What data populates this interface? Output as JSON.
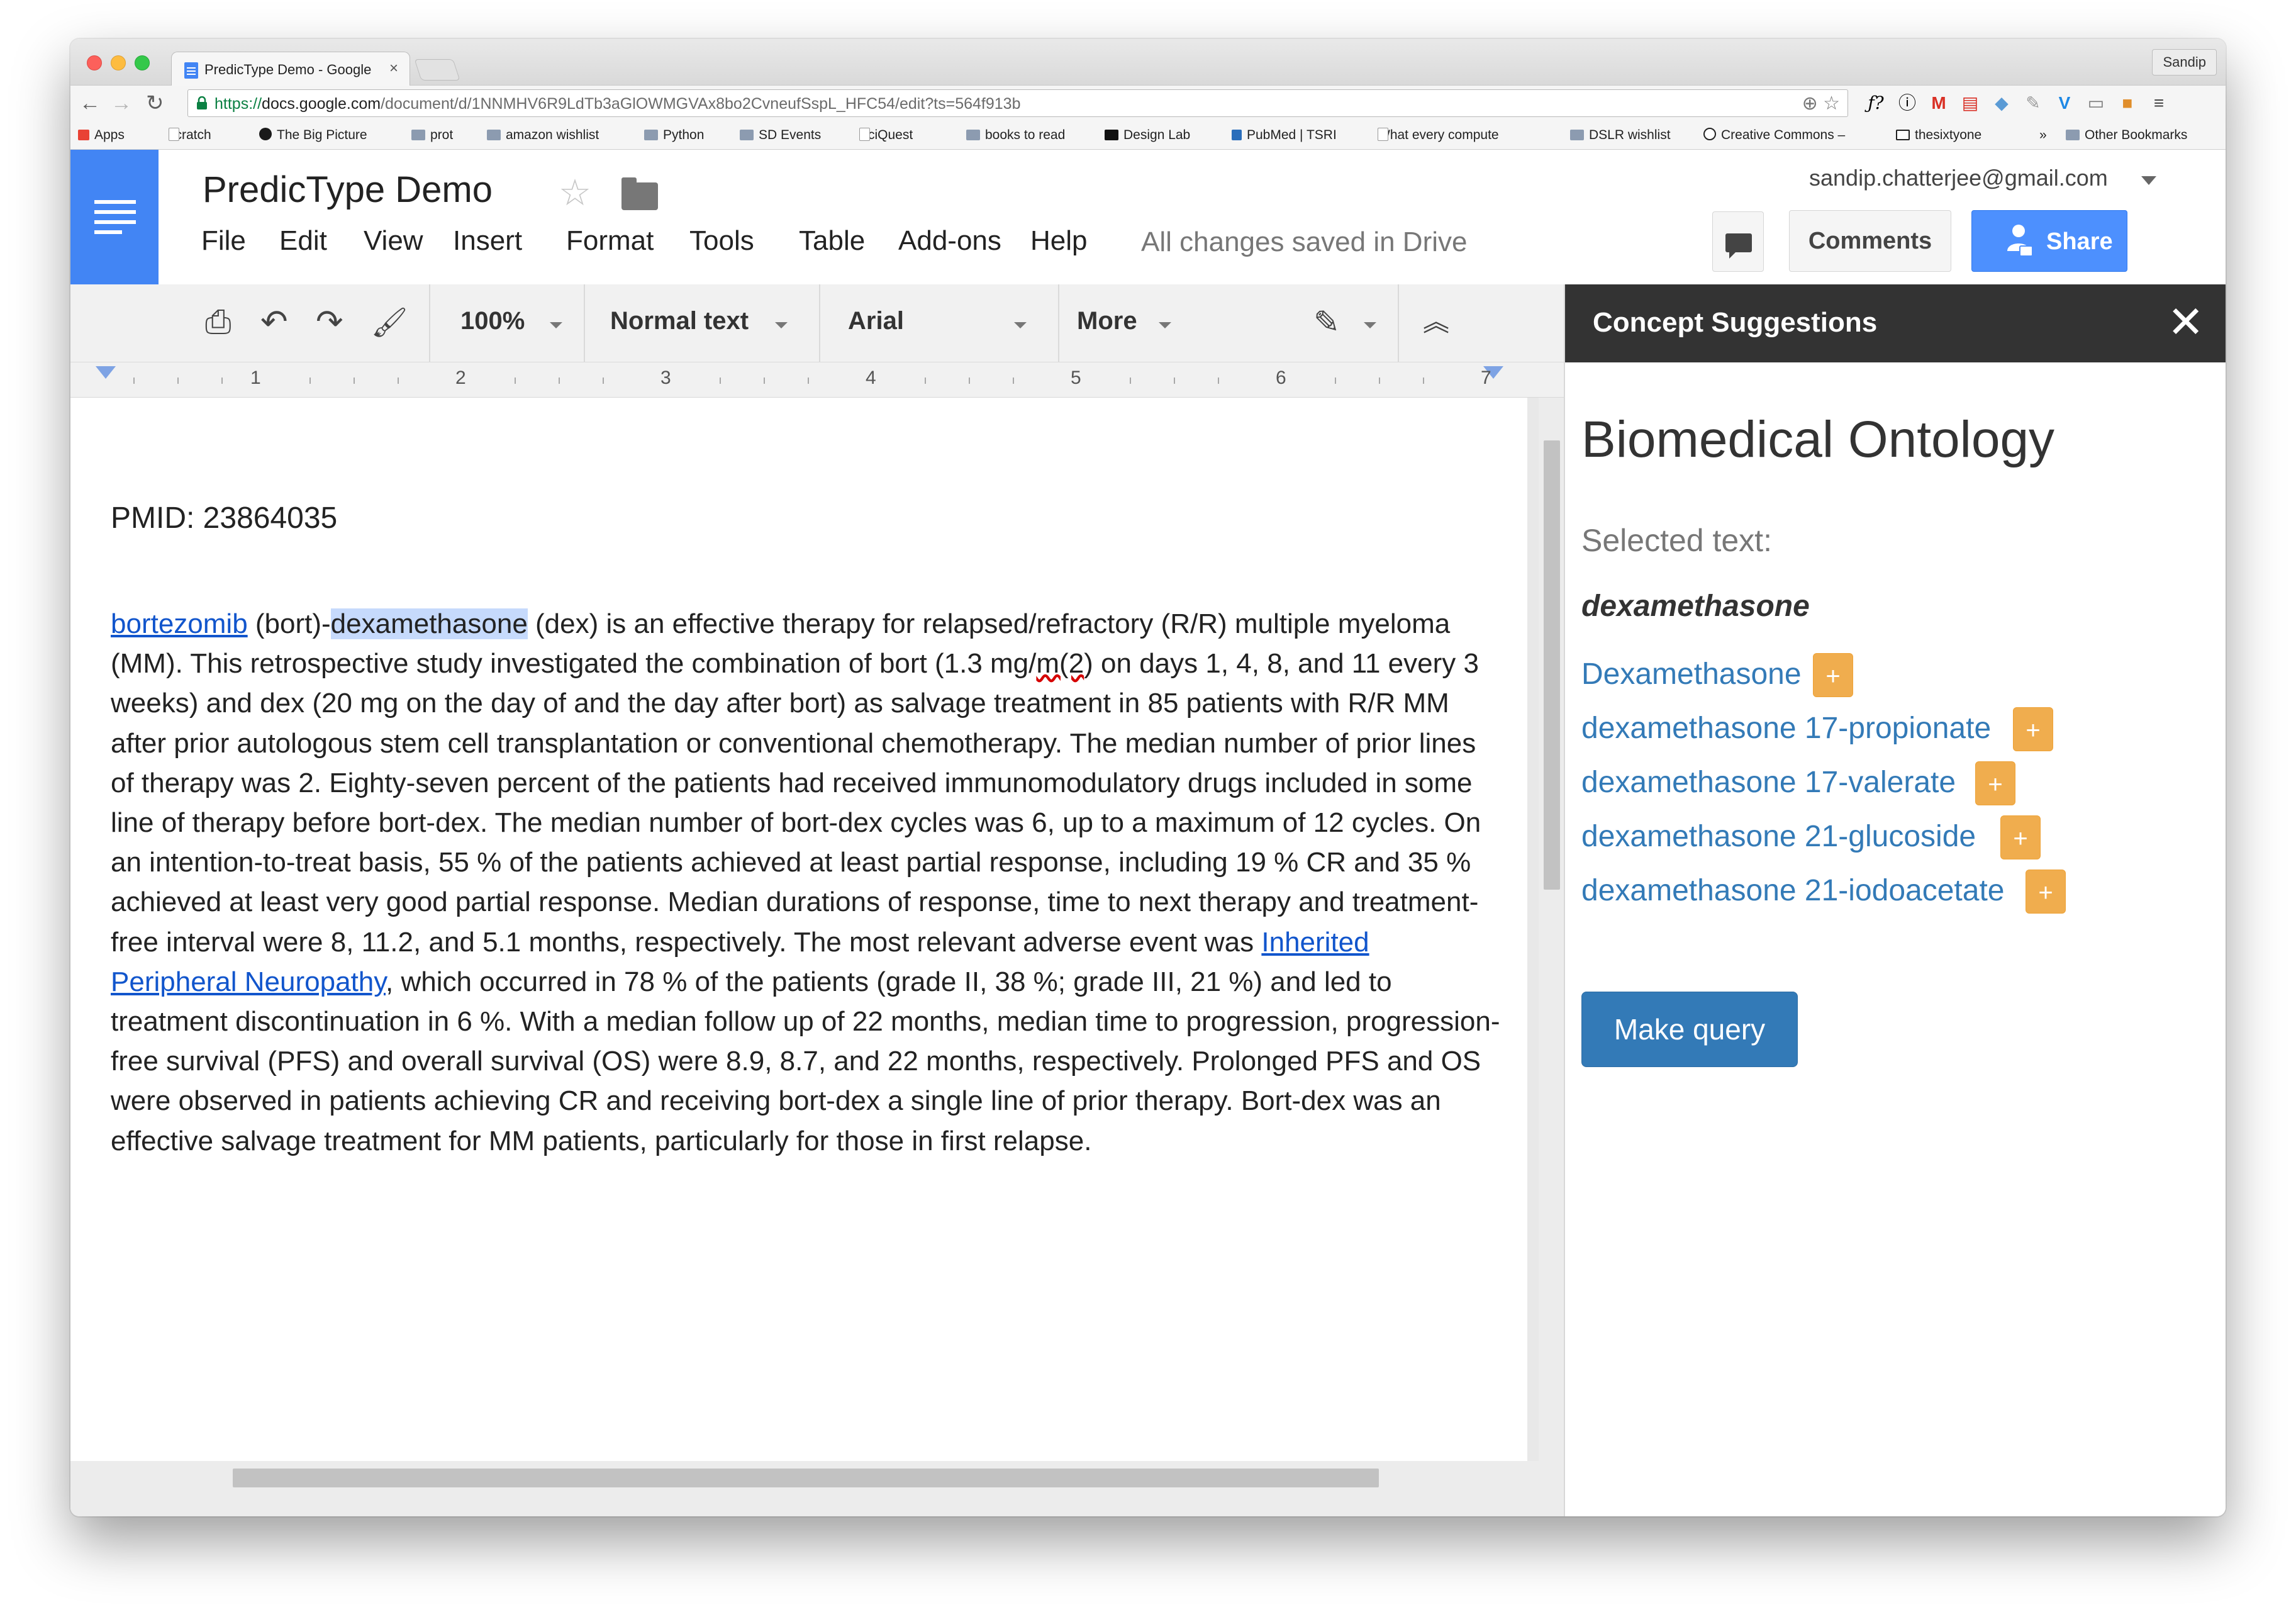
{
  "browser": {
    "tab_title": "PredicType Demo - Google",
    "tab_close": "×",
    "profile": "Sandip",
    "url": {
      "scheme": "https://",
      "host": "docs.google.com",
      "path": "/document/d/1NNMHV6R9LdTb3aGlOWMGVAx8bo2CvneufSspL_HFC54/edit?ts=564f913b"
    },
    "bookmarks": [
      {
        "label": "Apps",
        "icon": "apps-grid-icon"
      },
      {
        "label": "scratch",
        "icon": "page-icon"
      },
      {
        "label": "The Big Picture",
        "icon": "bookmark-b-icon"
      },
      {
        "label": "prot",
        "icon": "folder-icon"
      },
      {
        "label": "amazon wishlist",
        "icon": "folder-icon"
      },
      {
        "label": "Python",
        "icon": "folder-icon"
      },
      {
        "label": "SD Events",
        "icon": "folder-icon"
      },
      {
        "label": "SciQuest",
        "icon": "page-icon"
      },
      {
        "label": "books to read",
        "icon": "folder-icon"
      },
      {
        "label": "Design Lab",
        "icon": "dl-icon"
      },
      {
        "label": "PubMed | TSRI",
        "icon": "pubmed-icon"
      },
      {
        "label": "What every compute",
        "icon": "page-icon"
      },
      {
        "label": "DSLR wishlist",
        "icon": "folder-icon"
      },
      {
        "label": "Creative Commons –",
        "icon": "cc-icon"
      },
      {
        "label": "thesixtyone",
        "icon": "61-icon"
      },
      {
        "label": "»",
        "icon": ""
      },
      {
        "label": "Other Bookmarks",
        "icon": "folder-icon"
      }
    ]
  },
  "docs": {
    "title": "PredicType Demo",
    "menu": [
      "File",
      "Edit",
      "View",
      "Insert",
      "Format",
      "Tools",
      "Table",
      "Add-ons",
      "Help"
    ],
    "save_status": "All changes saved in Drive",
    "account": "sandip.chatterjee@gmail.com",
    "comments_label": "Comments",
    "share_label": "Share",
    "toolbar": {
      "zoom": "100%",
      "style": "Normal text",
      "font": "Arial",
      "more": "More"
    },
    "ruler_numbers": [
      "1",
      "2",
      "3",
      "4",
      "5",
      "6",
      "7"
    ]
  },
  "document": {
    "pmid": "PMID: 23864035",
    "p_link1": "bortezomib",
    "p_a": " (bort)-",
    "p_highlight": "dexamethasone",
    "p_b": " (dex) is an effective therapy for relapsed/refractory (R/R) multiple myeloma (MM). This retrospective study investigated the combination of bort (1.3 mg/",
    "p_squiggle": "m(2",
    "p_c": ") on days 1, 4, 8, and 11 every 3 weeks) and dex (20 mg on the day of and the day after bort) as salvage treatment in 85 patients with R/R MM after prior autologous stem cell transplantation or conventional chemotherapy. The median number of prior lines of therapy was 2. Eighty-seven percent of the patients had received immunomodulatory drugs included in some line of therapy before bort-dex. The median number of bort-dex cycles was 6, up to a maximum of 12 cycles. On an intention-to-treat basis, 55 % of the patients achieved at least partial response, including 19 % CR and 35 % achieved at least very good partial response. Median durations of response, time to next therapy and treatment-free interval were 8, 11.2, and 5.1 months, respectively. The most relevant adverse event was ",
    "p_link2": "Inherited Peripheral Neuropathy",
    "p_d": ", which occurred in 78 % of the patients (grade II, 38 %; grade III, 21 %) and led to treatment discontinuation in 6 %. With a median follow up of 22 months, median time to progression, progression-free survival (PFS) and overall survival (OS) were 8.9, 8.7, and 22 months, respectively. Prolonged PFS and OS were observed in patients achieving CR and receiving bort-dex a single line of prior therapy. Bort-dex was an effective salvage treatment for MM patients, particularly for those in first relapse."
  },
  "sidebar": {
    "header": "Concept Suggestions",
    "close": "✕",
    "ontology_title": "Biomedical Ontology",
    "selected_label": "Selected text:",
    "selected_term": "dexamethasone",
    "concepts": [
      {
        "label": "Dexamethasone",
        "add": "+"
      },
      {
        "label": "dexamethasone 17-propionate",
        "add": "+"
      },
      {
        "label": "dexamethasone 17-valerate",
        "add": "+"
      },
      {
        "label": "dexamethasone 21-glucoside",
        "add": "+"
      },
      {
        "label": "dexamethasone 21-iodoacetate",
        "add": "+"
      }
    ],
    "query_button": "Make query"
  },
  "colors": {
    "docs_blue": "#4285f4",
    "share_blue": "#4d90fe",
    "link_blue": "#337ab7",
    "add_orange": "#f0ad4e",
    "sidebar_header": "#333333",
    "selection_highlight": "#c6dafc"
  }
}
